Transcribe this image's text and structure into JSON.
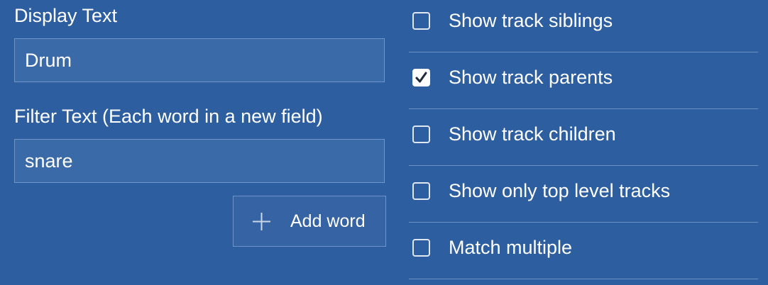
{
  "display_text": {
    "label": "Display Text",
    "value": "Drum"
  },
  "filter_text": {
    "label": "Filter Text (Each word in a new field)",
    "words": [
      "snare"
    ]
  },
  "add_word_button": {
    "label": "Add word",
    "icon": "plus-icon"
  },
  "options": [
    {
      "label": "Show track siblings",
      "checked": false
    },
    {
      "label": "Show track parents",
      "checked": true
    },
    {
      "label": "Show track children",
      "checked": false
    },
    {
      "label": "Show only top level tracks",
      "checked": false
    },
    {
      "label": "Match multiple",
      "checked": false
    }
  ],
  "colors": {
    "background": "#2d5ea0",
    "input_background": "#3b6aa8",
    "input_border": "#6f94c8",
    "divider": "#6d8fc0",
    "text": "#ffffff"
  }
}
